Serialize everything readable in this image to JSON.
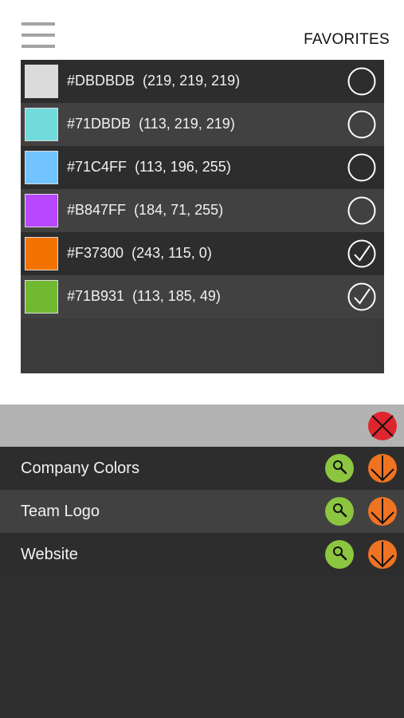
{
  "header": {
    "title": "FAVORITES",
    "menu_icon": "hamburger-menu-icon"
  },
  "colors": [
    {
      "hex": "#DBDBDB",
      "rgb": "(219, 219, 219)",
      "swatch": "#DBDBDB",
      "selected": false
    },
    {
      "hex": "#71DBDB",
      "rgb": "(113, 219, 219)",
      "swatch": "#71DBDB",
      "selected": false
    },
    {
      "hex": "#71C4FF",
      "rgb": "(113, 196, 255)",
      "swatch": "#71C4FF",
      "selected": false
    },
    {
      "hex": "#B847FF",
      "rgb": "(184, 71, 255)",
      "swatch": "#B847FF",
      "selected": false
    },
    {
      "hex": "#F37300",
      "rgb": "(243, 115, 0)",
      "swatch": "#F37300",
      "selected": true
    },
    {
      "hex": "#71B931",
      "rgb": "(113, 185, 49)",
      "swatch": "#71B931",
      "selected": true
    }
  ],
  "palettes": [
    {
      "label": "Company Colors"
    },
    {
      "label": "Team Logo"
    },
    {
      "label": "Website"
    }
  ],
  "theme": {
    "close_red": "#e0262d",
    "search_green": "#8cc540",
    "download_orange": "#f07322"
  }
}
